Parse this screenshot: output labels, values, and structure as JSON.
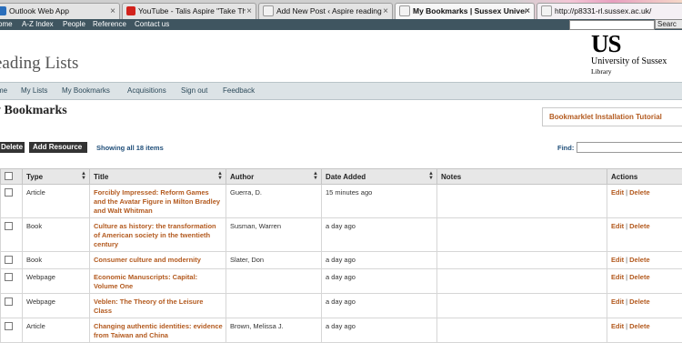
{
  "browser": {
    "tabs": [
      {
        "label": "Outlook Web App",
        "icon": "outlook-icon"
      },
      {
        "label": "YouTube - Talis Aspire \"Take Th...",
        "icon": "youtube-icon"
      },
      {
        "label": "Add New Post ‹ Aspire reading li...",
        "icon": "page-icon"
      },
      {
        "label": "My Bookmarks | Sussex Univer...",
        "icon": "page-icon"
      },
      {
        "label": "http://p8331-rl.sussex.ac.uk/",
        "icon": "page-icon"
      }
    ]
  },
  "topnav": {
    "items": [
      "ome",
      "A-Z Index",
      "People",
      "Reference",
      "Contact us"
    ],
    "search_button": "Searc"
  },
  "header": {
    "site_title": "eading Lists",
    "logo": {
      "mark": "US",
      "name": "University of Sussex",
      "sub": "Library"
    }
  },
  "mainnav": {
    "items": [
      "me",
      "My Lists",
      "My Bookmarks",
      "Acquisitions",
      "Sign out",
      "Feedback"
    ]
  },
  "page": {
    "title": "y Bookmarks",
    "bookmarklet_link": "Bookmarklet Installation Tutorial",
    "delete_button": "Delete",
    "add_resource_button": "Add Resource",
    "showing": "Showing all 18 items",
    "find_label": "Find:"
  },
  "table": {
    "headers": {
      "type": "Type",
      "title": "Title",
      "author": "Author",
      "date_added": "Date Added",
      "notes": "Notes",
      "actions": "Actions"
    },
    "edit_label": "Edit",
    "delete_label": "Delete",
    "action_separator": "|",
    "rows": [
      {
        "type": "Article",
        "title": "Forcibly Impressed: Reform Games and the Avatar Figure in Milton Bradley and Walt Whitman",
        "author": "Guerra, D.",
        "date_added": "15 minutes ago",
        "notes": ""
      },
      {
        "type": "Book",
        "title": "Culture as history: the transformation of American society in the twentieth century",
        "author": "Susman, Warren",
        "date_added": "a day ago",
        "notes": ""
      },
      {
        "type": "Book",
        "title": "Consumer culture and modernity",
        "author": "Slater, Don",
        "date_added": "a day ago",
        "notes": ""
      },
      {
        "type": "Webpage",
        "title": "Economic Manuscripts: Capital: Volume One",
        "author": "",
        "date_added": "a day ago",
        "notes": ""
      },
      {
        "type": "Webpage",
        "title": "Veblen: The Theory of the Leisure Class",
        "author": "",
        "date_added": "a day ago",
        "notes": ""
      },
      {
        "type": "Article",
        "title": "Changing authentic identities: evidence from Taiwan and China",
        "author": "Brown, Melissa J.",
        "date_added": "a day ago",
        "notes": ""
      }
    ]
  }
}
